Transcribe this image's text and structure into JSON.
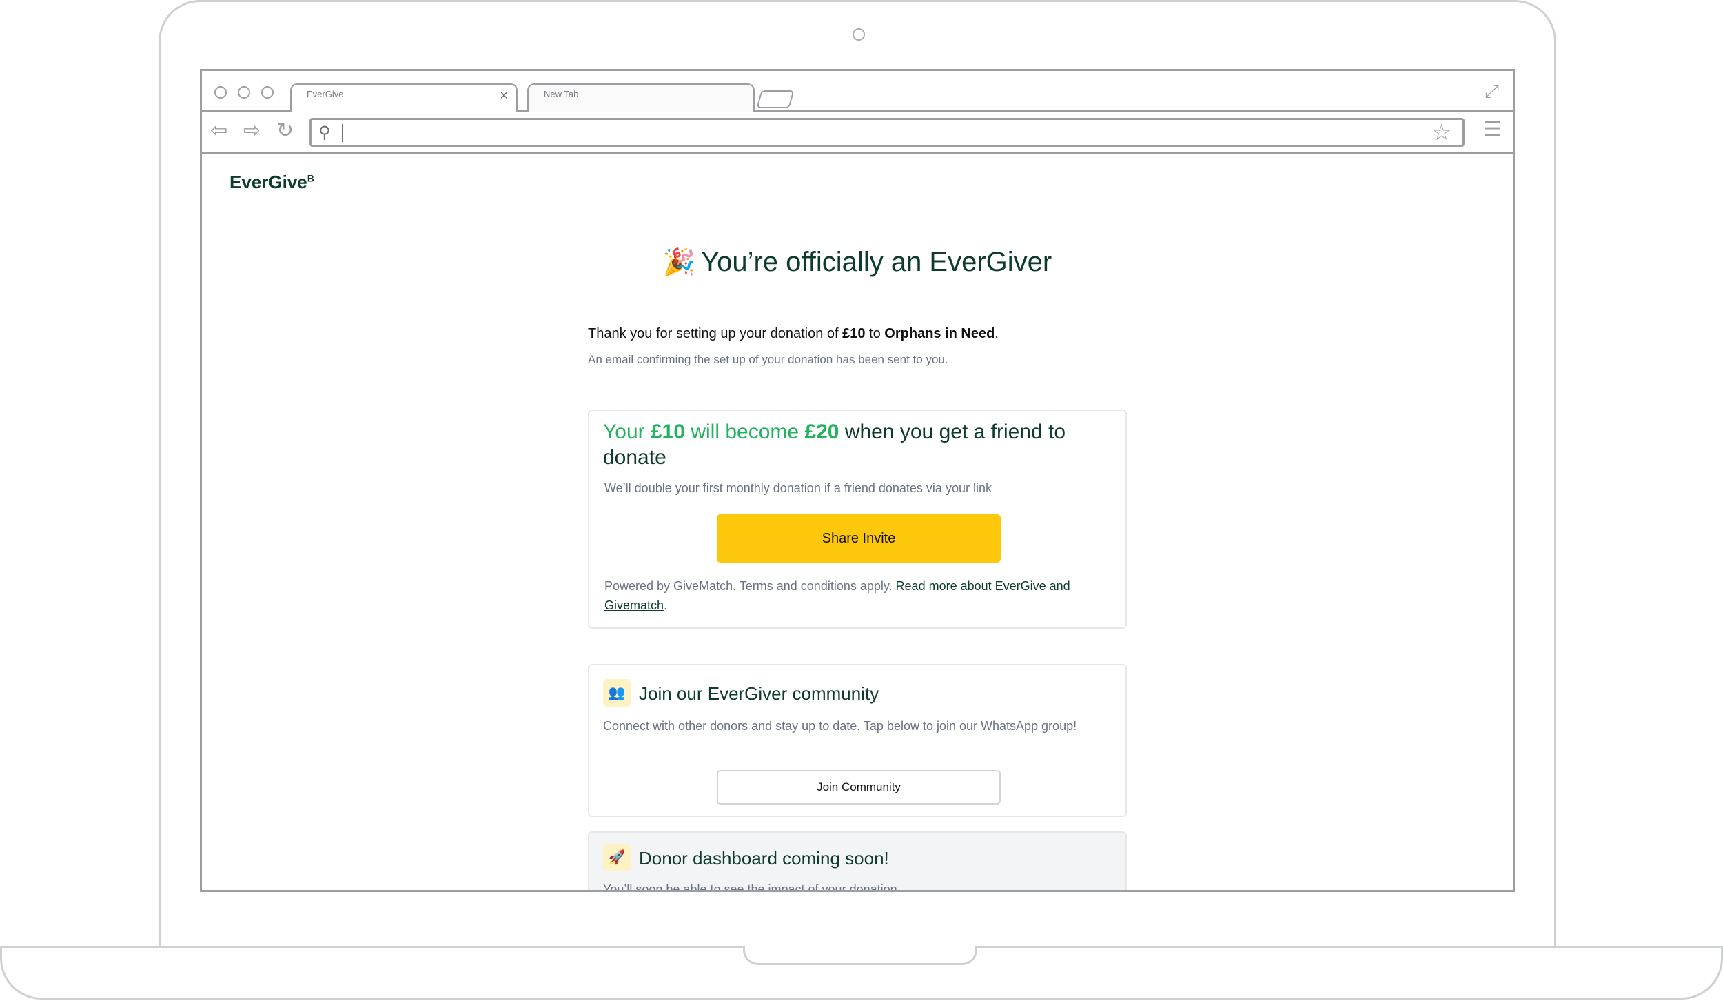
{
  "browser": {
    "active_tab_label": "EverGive",
    "inactive_tab_label": "New Tab",
    "address_value": ""
  },
  "site": {
    "logo_text": "EverGive",
    "logo_superscript": "B"
  },
  "confirmation": {
    "title": "You’re officially an EverGiver",
    "thanks_prefix": "Thank you for setting up your donation of ",
    "amount": "£10",
    "thanks_middle": " to ",
    "charity": "Orphans in Need",
    "thanks_suffix": ".",
    "email_note": "An email confirming the set up of your donation has been sent to you."
  },
  "match_card": {
    "heading_your": "Your ",
    "heading_amount": "£10",
    "heading_will_become": " will become ",
    "heading_doubled": "£20",
    "heading_rest": " when you get a friend to donate",
    "subtext": "We’ll double your first monthly donation if a friend donates via your link",
    "share_button": "Share Invite",
    "powered_text": "Powered by GiveMatch. Terms and conditions apply. ",
    "read_more_link": "Read more about EverGive and Givematch",
    "powered_suffix": "."
  },
  "community_card": {
    "title": "Join our EverGiver community",
    "description": "Connect with other donors and stay up to date. Tap below to join our WhatsApp group!",
    "button": "Join Community"
  },
  "dashboard_card": {
    "title": "Donor dashboard coming soon!",
    "description": "You’ll soon be able to see the impact of your donation"
  },
  "colors": {
    "brand_dark_green": "#0e3b2e",
    "accent_green": "#22b35e",
    "button_yellow": "#fdc70c",
    "muted_text": "#6b7280"
  },
  "icons": [
    "party-popper-icon",
    "users-icon",
    "rocket-icon",
    "search-icon",
    "star-icon",
    "menu-icon",
    "back-arrow-icon",
    "forward-arrow-icon",
    "reload-icon",
    "expand-icon",
    "close-icon"
  ]
}
